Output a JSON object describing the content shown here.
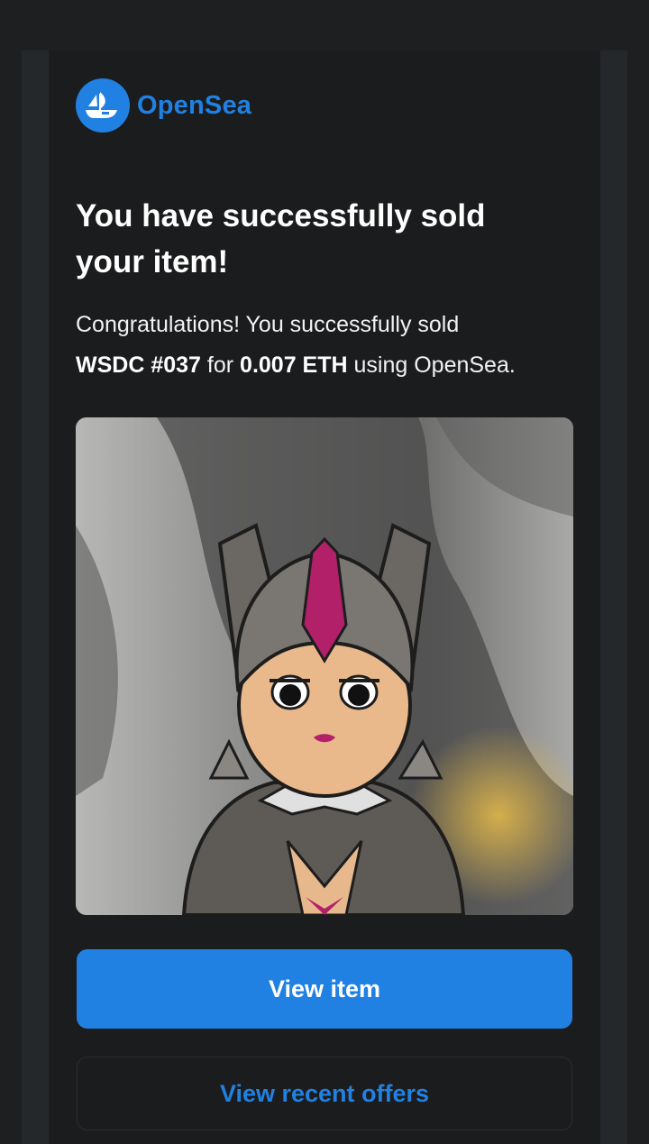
{
  "brand": {
    "name": "OpenSea",
    "logo_icon": "opensea-boat-icon",
    "color": "#2081e2"
  },
  "headline": {
    "line1": "You have successfully sold",
    "line2": "your item!"
  },
  "message": {
    "intro": "Congratulations! You successfully sold",
    "item_name": "WSDC #037",
    "for_text": "for",
    "price": "0.007 ETH",
    "suffix": "using OpenSea."
  },
  "nft": {
    "image_icon": "nft-character-artwork"
  },
  "actions": {
    "primary_label": "View item",
    "secondary_label": "View recent offers"
  },
  "colors": {
    "accent": "#2081e2",
    "background": "#1b1c1d",
    "frame": "#25282b"
  }
}
